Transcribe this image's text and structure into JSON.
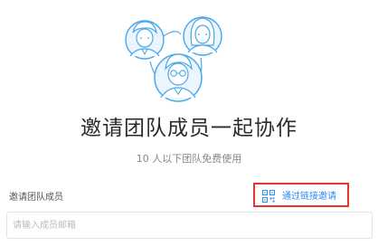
{
  "colors": {
    "accent": "#2d8cf0",
    "highlight_border": "#e5352c",
    "illustration_stroke": "#49a9e8",
    "illustration_fill": "#eaf5fd"
  },
  "invite": {
    "title": "邀请团队成员一起协作",
    "subtitle": "10 人以下团队免费使用",
    "section_label": "邀请团队成员",
    "link_label": "通过链接邀请",
    "link_icon": "qr-code-icon",
    "email_placeholder": "请输入成员邮箱",
    "email_value": ""
  }
}
